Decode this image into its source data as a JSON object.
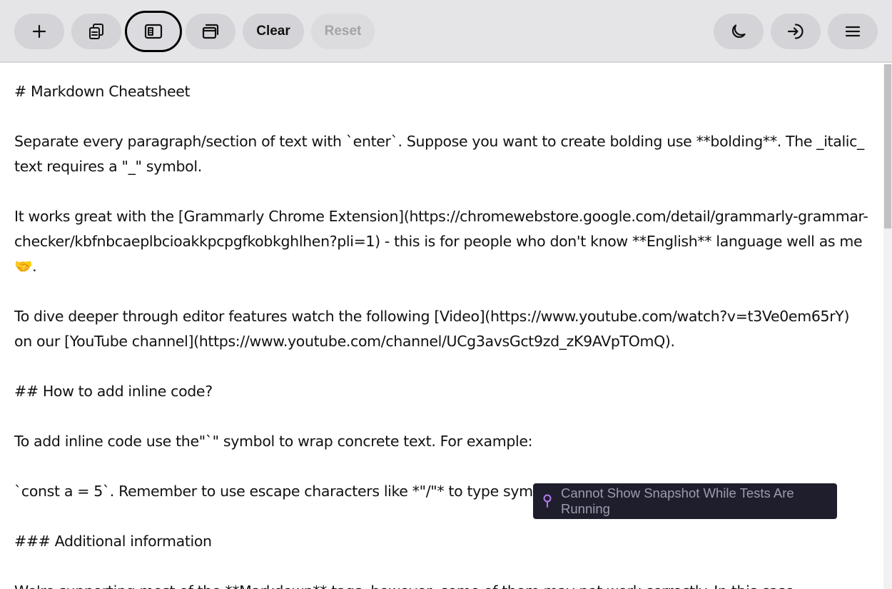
{
  "toolbar": {
    "add_icon": "plus-icon",
    "copy_icon": "copy-icon",
    "split_view_icon": "sidebar-layout-icon",
    "window_icon": "windows-icon",
    "clear_label": "Clear",
    "reset_label": "Reset",
    "theme_icon": "moon-icon",
    "login_icon": "sign-in-icon",
    "menu_icon": "hamburger-menu-icon"
  },
  "editor": {
    "content": "# Markdown Cheatsheet\n\nSeparate every paragraph/section of text with `enter`. Suppose you want to create bolding use **bolding**. The _italic_ text requires a \"_\" symbol.\n\nIt works great with the [Grammarly Chrome Extension](https://chromewebstore.google.com/detail/grammarly-grammar-checker/kbfnbcaeplbcioakkpcpgfkobkghlhen?pli=1) - this is for people who don't know **English** language well as me 🤝.\n\nTo dive deeper through editor features watch the following [Video](https://www.youtube.com/watch?v=t3Ve0em65rY) on our [YouTube channel](https://www.youtube.com/channel/UCg3avsGct9zd_zK9AVpTOmQ).\n\n## How to add inline code?\n\nTo add inline code use the\"`\" symbol to wrap concrete text. For example:\n\n`const a = 5`. Remember to use escape characters like *\"/\"* to type symbols.\n\n### Additional information\n\nWe're supporting most of the **Markdown** tags, however, some of them may not work correctly. In this case"
  },
  "toast": {
    "icon": "pin-icon",
    "message": "Cannot Show Snapshot While Tests Are Running"
  }
}
